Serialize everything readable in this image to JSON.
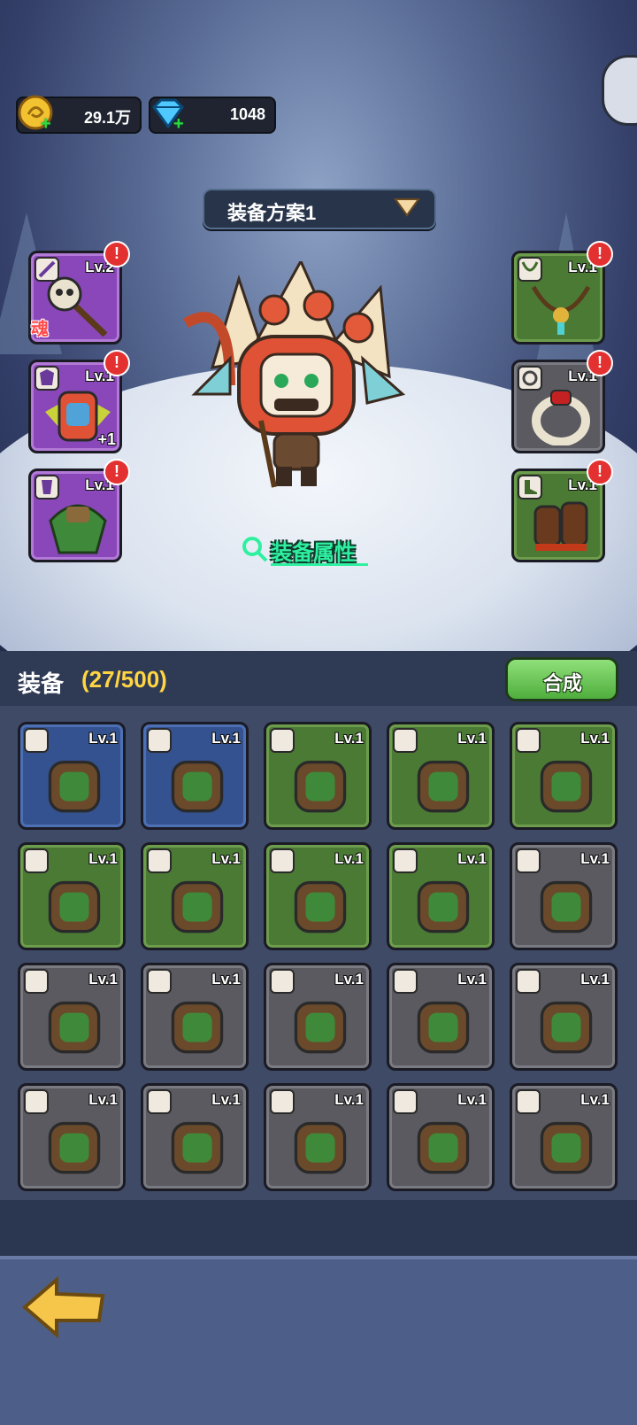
{
  "resources": {
    "gold": {
      "value": "29.1万",
      "icon": "gold-coin-icon"
    },
    "gems": {
      "value": "1048",
      "icon": "diamond-icon"
    }
  },
  "plan": {
    "label": "装备方案1"
  },
  "equipped_left": [
    {
      "level": "Lv.2",
      "item": "skull-staff",
      "extra": "魂",
      "alert": "!"
    },
    {
      "level": "Lv.1",
      "item": "tiki-mask-armor",
      "extra": "+1",
      "alert": "!"
    },
    {
      "level": "Lv.1",
      "item": "leaf-cloak",
      "alert": "!"
    }
  ],
  "equipped_right": [
    {
      "level": "Lv.1",
      "item": "vine-necklace",
      "alert": "!"
    },
    {
      "level": "Lv.1",
      "item": "red-gem-ring",
      "alert": "!"
    },
    {
      "level": "Lv.1",
      "item": "fur-boots",
      "alert": "!"
    }
  ],
  "attr_link": {
    "label": "装备属性"
  },
  "inventory": {
    "title": "装备",
    "count": "(27/500)",
    "craft_label": "合成",
    "items": [
      {
        "level": "Lv.1",
        "rarity": "blue",
        "item": "leaf-cloak"
      },
      {
        "level": "Lv.1",
        "rarity": "blue",
        "item": "wood-armor"
      },
      {
        "level": "Lv.1",
        "rarity": "green",
        "item": "leaf-boots"
      },
      {
        "level": "Lv.1",
        "rarity": "green",
        "item": "claw-necklace"
      },
      {
        "level": "Lv.1",
        "rarity": "green",
        "item": "leaf-cloak"
      },
      {
        "level": "Lv.1",
        "rarity": "green",
        "item": "tiki-mask-armor"
      },
      {
        "level": "Lv.1",
        "rarity": "green",
        "item": "tiki-mask-armor"
      },
      {
        "level": "Lv.1",
        "rarity": "green",
        "item": "wood-armor"
      },
      {
        "level": "Lv.1",
        "rarity": "green",
        "item": "crystal-staff"
      },
      {
        "level": "Lv.1",
        "rarity": "gray",
        "item": "fur-boots"
      },
      {
        "level": "Lv.1",
        "rarity": "gray",
        "item": "red-gem-ring"
      },
      {
        "level": "Lv.1",
        "rarity": "gray",
        "item": "horn-ring"
      },
      {
        "level": "Lv.1",
        "rarity": "gray",
        "item": "claw-necklace"
      },
      {
        "level": "Lv.1",
        "rarity": "gray",
        "item": "skull-necklace"
      },
      {
        "level": "Lv.1",
        "rarity": "gray",
        "item": "leaf-cape"
      },
      {
        "level": "Lv.1",
        "rarity": "gray",
        "item": "leaf-cape"
      },
      {
        "level": "Lv.1",
        "rarity": "gray",
        "item": "fur-cloak"
      },
      {
        "level": "Lv.1",
        "rarity": "gray",
        "item": "fur-cloak"
      },
      {
        "level": "Lv.1",
        "rarity": "gray",
        "item": "hooded-cape"
      },
      {
        "level": "Lv.1",
        "rarity": "gray",
        "item": "leaf-cloak"
      }
    ]
  },
  "colors": {
    "accent_gold": "#ffd542",
    "accent_green": "#2ef0a0",
    "alert_red": "#e33131"
  }
}
